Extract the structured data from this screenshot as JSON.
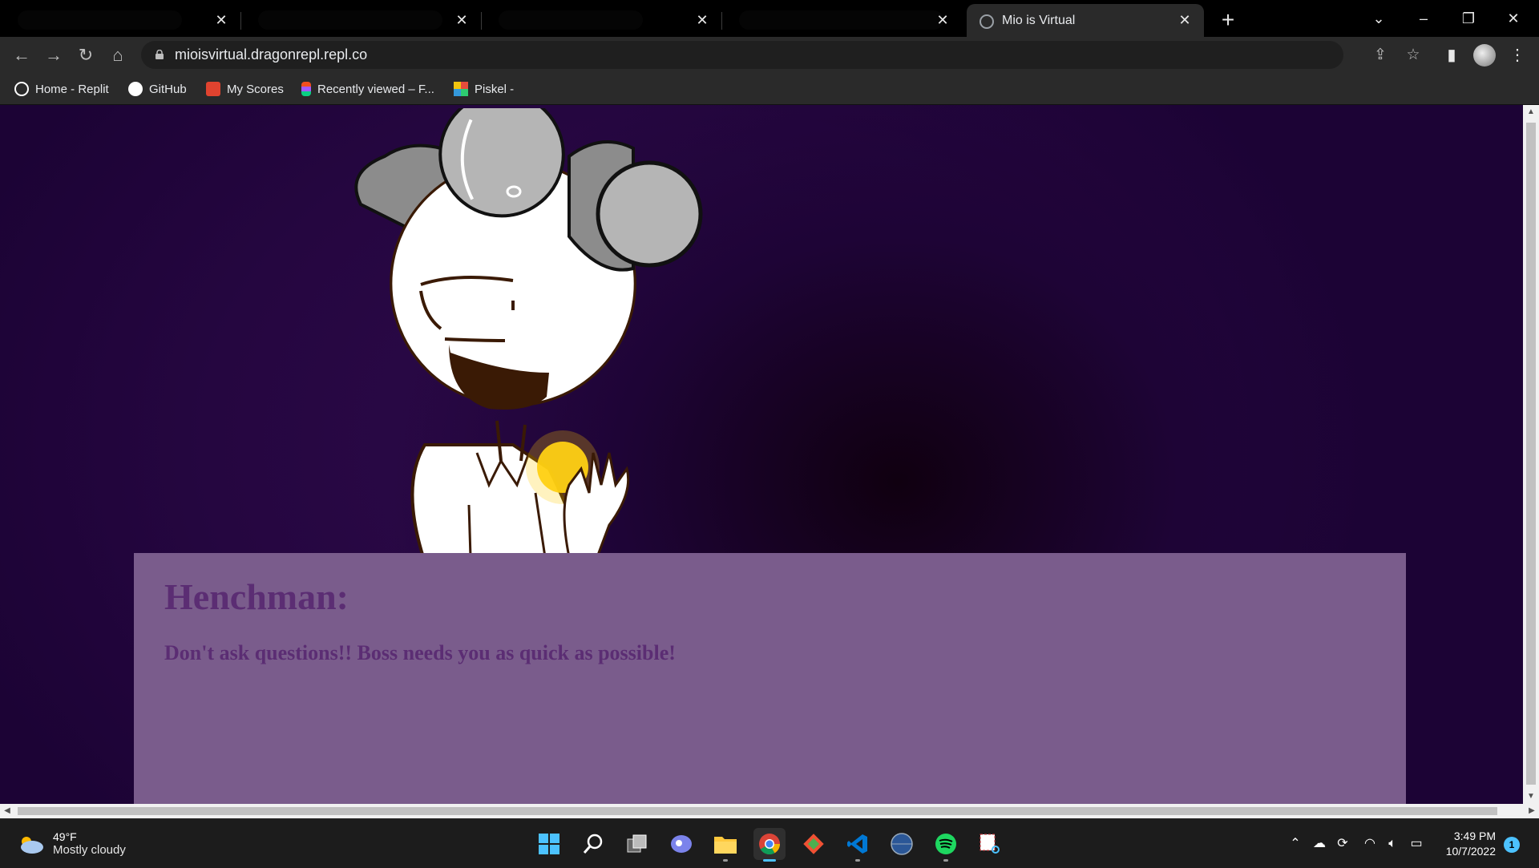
{
  "browser": {
    "tabs": [
      {
        "label": "",
        "redacted": true
      },
      {
        "label": "",
        "redacted": true
      },
      {
        "label": "",
        "redacted": true
      },
      {
        "label": "",
        "redacted": true
      },
      {
        "label": "Mio is Virtual",
        "active": true
      }
    ],
    "url": "mioisvirtual.dragonrepl.repl.co",
    "bookmarks": [
      {
        "label": "Home - Replit",
        "icon": "replit-icon"
      },
      {
        "label": "GitHub",
        "icon": "github-icon"
      },
      {
        "label": "My Scores",
        "icon": "scores-icon"
      },
      {
        "label": "Recently viewed – F...",
        "icon": "figma-icon"
      },
      {
        "label": "Piskel -",
        "icon": "piskel-icon"
      }
    ]
  },
  "page": {
    "dialog": {
      "speaker": "Henchman:",
      "text": "Don't ask questions!! Boss needs you as quick as possible!"
    },
    "colors": {
      "background": "#250640",
      "dialog_box": "#7a5c8c",
      "dialog_text": "#5b2d73"
    }
  },
  "taskbar": {
    "weather": {
      "temp": "49°F",
      "description": "Mostly cloudy"
    },
    "apps": [
      "start-icon",
      "search-icon",
      "task-view-icon",
      "chat-icon",
      "file-explorer-icon",
      "chrome-icon",
      "git-icon",
      "vscode-icon",
      "browser-globe-icon",
      "spotify-icon",
      "snipping-tool-icon"
    ],
    "clock": {
      "time": "3:49 PM",
      "date": "10/7/2022"
    },
    "notification_count": "1"
  }
}
